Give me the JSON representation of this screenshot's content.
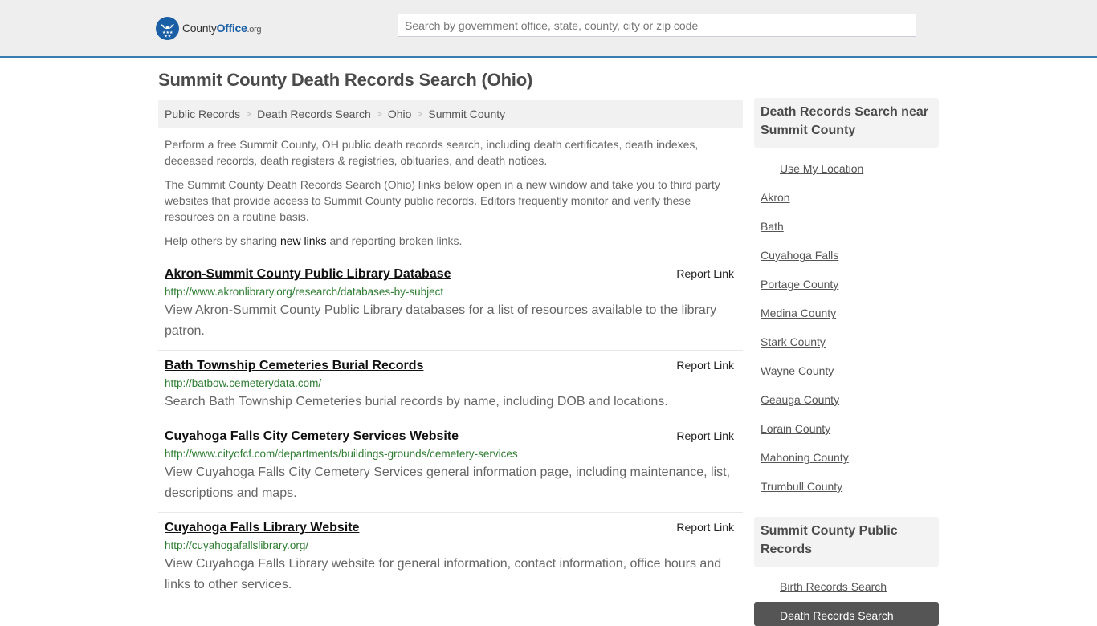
{
  "header": {
    "logo": {
      "county": "County",
      "office": "Office",
      "org": ".org"
    },
    "search_placeholder": "Search by government office, state, county, city or zip code",
    "accent_color": "#3a7bb0",
    "brand_color": "#1a5fa6"
  },
  "page_title": "Summit County Death Records Search (Ohio)",
  "breadcrumb": [
    {
      "label": "Public Records"
    },
    {
      "label": "Death Records Search"
    },
    {
      "label": "Ohio"
    },
    {
      "label": "Summit County"
    }
  ],
  "breadcrumb_separator": ">",
  "intro": {
    "p1": "Perform a free Summit County, OH public death records search, including death certificates, death indexes, deceased records, death registers & registries, obituaries, and death notices.",
    "p2": "The Summit County Death Records Search (Ohio) links below open in a new window and take you to third party websites that provide access to Summit County public records. Editors frequently monitor and verify these resources on a routine basis.",
    "p3_before": "Help others by sharing ",
    "p3_link": "new links",
    "p3_after": " and reporting broken links."
  },
  "results": [
    {
      "title": "Akron-Summit County Public Library Database",
      "report_label": "Report Link",
      "url": "http://www.akronlibrary.org/research/databases-by-subject",
      "description": "View Akron-Summit County Public Library databases for a list of resources available to the library patron."
    },
    {
      "title": "Bath Township Cemeteries Burial Records",
      "report_label": "Report Link",
      "url": "http://batbow.cemeterydata.com/",
      "description": "Search Bath Township Cemeteries burial records by name, including DOB and locations."
    },
    {
      "title": "Cuyahoga Falls City Cemetery Services Website",
      "report_label": "Report Link",
      "url": "http://www.cityofcf.com/departments/buildings-grounds/cemetery-services",
      "description": "View Cuyahoga Falls City Cemetery Services general information page, including maintenance, list, descriptions and maps."
    },
    {
      "title": "Cuyahoga Falls Library Website",
      "report_label": "Report Link",
      "url": "http://cuyahogafallslibrary.org/",
      "description": "View Cuyahoga Falls Library website for general information, contact information, office hours and links to other services."
    }
  ],
  "sidebar": {
    "nearby_title": "Death Records Search near Summit County",
    "use_location": "Use My Location",
    "nearby": [
      "Akron",
      "Bath",
      "Cuyahoga Falls",
      "Portage County",
      "Medina County",
      "Stark County",
      "Wayne County",
      "Geauga County",
      "Lorain County",
      "Mahoning County",
      "Trumbull County"
    ],
    "records_title": "Summit County Public Records",
    "records_links": [
      {
        "label": "Birth Records Search",
        "active": false
      },
      {
        "label": "Death Records Search",
        "active": true
      }
    ]
  }
}
